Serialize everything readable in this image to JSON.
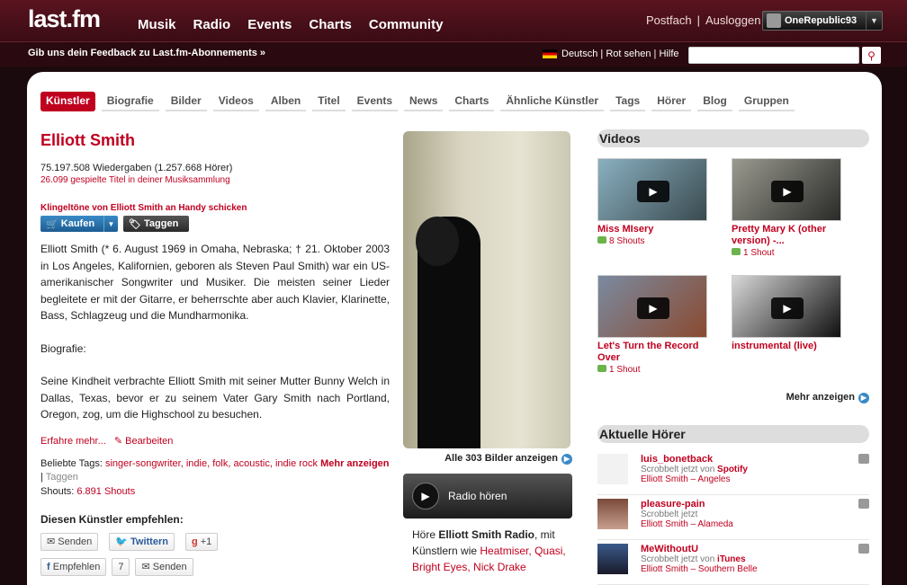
{
  "header": {
    "logo": "last.fm",
    "nav": [
      "Musik",
      "Radio",
      "Events",
      "Charts",
      "Community"
    ],
    "postfach": "Postfach",
    "ausloggen": "Ausloggen",
    "user": "OneRepublic93"
  },
  "subbar": {
    "feedback": "Gib uns dein Feedback zu Last.fm-Abonnements »",
    "lang": "Deutsch",
    "rot": "Rot sehen",
    "hilfe": "Hilfe"
  },
  "tabs": [
    "Künstler",
    "Biografie",
    "Bilder",
    "Videos",
    "Alben",
    "Titel",
    "Events",
    "News",
    "Charts",
    "Ähnliche Künstler",
    "Tags",
    "Hörer",
    "Blog",
    "Gruppen"
  ],
  "artist": {
    "name": "Elliott Smith",
    "plays": "75.197.508 Wiedergaben (1.257.668 Hörer)",
    "library": "26.099 gespielte Titel in deiner Musiksammlung",
    "ringtones": "Klingeltöne von Elliott Smith an Handy schicken",
    "buy": "Kaufen",
    "tag": "Taggen",
    "bio1": "Elliott Smith (* 6. August 1969 in Omaha, Nebraska; † 21. Oktober 2003 in Los Angeles, Kalifornien, geboren als Steven Paul Smith) war ein US-amerikanischer Songwriter und Musiker. Die meisten seiner Lieder begleitete er mit der Gitarre, er beherrschte aber auch Klavier, Klarinette, Bass, Schlagzeug und die Mundharmonika.",
    "bio2": "Biografie:",
    "bio3": "Seine Kindheit verbrachte Elliott Smith mit seiner Mutter Bunny Welch in Dallas, Texas, bevor er zu seinem Vater Gary Smith nach Portland, Oregon, zog, um die Highschool zu besuchen.",
    "more": "Erfahre mehr...",
    "edit": "Bearbeiten",
    "tags_label": "Beliebte Tags:",
    "tags": [
      "singer-songwriter,",
      "indie,",
      "folk,",
      "acoustic,",
      "indie rock"
    ],
    "tags_more": "Mehr anzeigen",
    "tags_taggen": "Taggen",
    "shouts_label": "Shouts:",
    "shouts": "6.891 Shouts",
    "recommend": "Diesen Künstler empfehlen:",
    "send": "Senden",
    "twitter": "Twittern",
    "gplus": "+1",
    "fb": "Empfehlen",
    "fbcount": "7",
    "send2": "Senden"
  },
  "media": {
    "images": "Alle 303 Bilder anzeigen",
    "radio": "Radio hören",
    "radio_pre": "Höre ",
    "radio_name": "Elliott Smith Radio",
    "radio_mid": ", mit Künstlern wie ",
    "radio_a1": "Heatmiser,",
    "radio_a2": "Quasi,",
    "radio_a3": "Bright Eyes,",
    "radio_a4": "Nick Drake"
  },
  "videos": {
    "heading": "Videos",
    "items": [
      {
        "title": "Miss MIsery",
        "shouts": "8 Shouts"
      },
      {
        "title": "Pretty Mary K (other version) -...",
        "shouts": "1 Shout"
      },
      {
        "title": "Let's Turn the Record Over",
        "shouts": "1 Shout"
      },
      {
        "title": "instrumental (live)",
        "shouts": ""
      }
    ],
    "more": "Mehr anzeigen"
  },
  "listeners": {
    "heading": "Aktuelle Hörer",
    "items": [
      {
        "name": "luis_bonetback",
        "status": "Scrobbelt jetzt von",
        "src": "Spotify",
        "track": "Elliott Smith – Angeles"
      },
      {
        "name": "pleasure-pain",
        "status": "Scrobbelt jetzt",
        "src": "",
        "track": "Elliott Smith – Alameda"
      },
      {
        "name": "MeWithoutU",
        "status": "Scrobbelt jetzt von",
        "src": "iTunes",
        "track": "Elliott Smith – Southern Belle"
      }
    ]
  }
}
